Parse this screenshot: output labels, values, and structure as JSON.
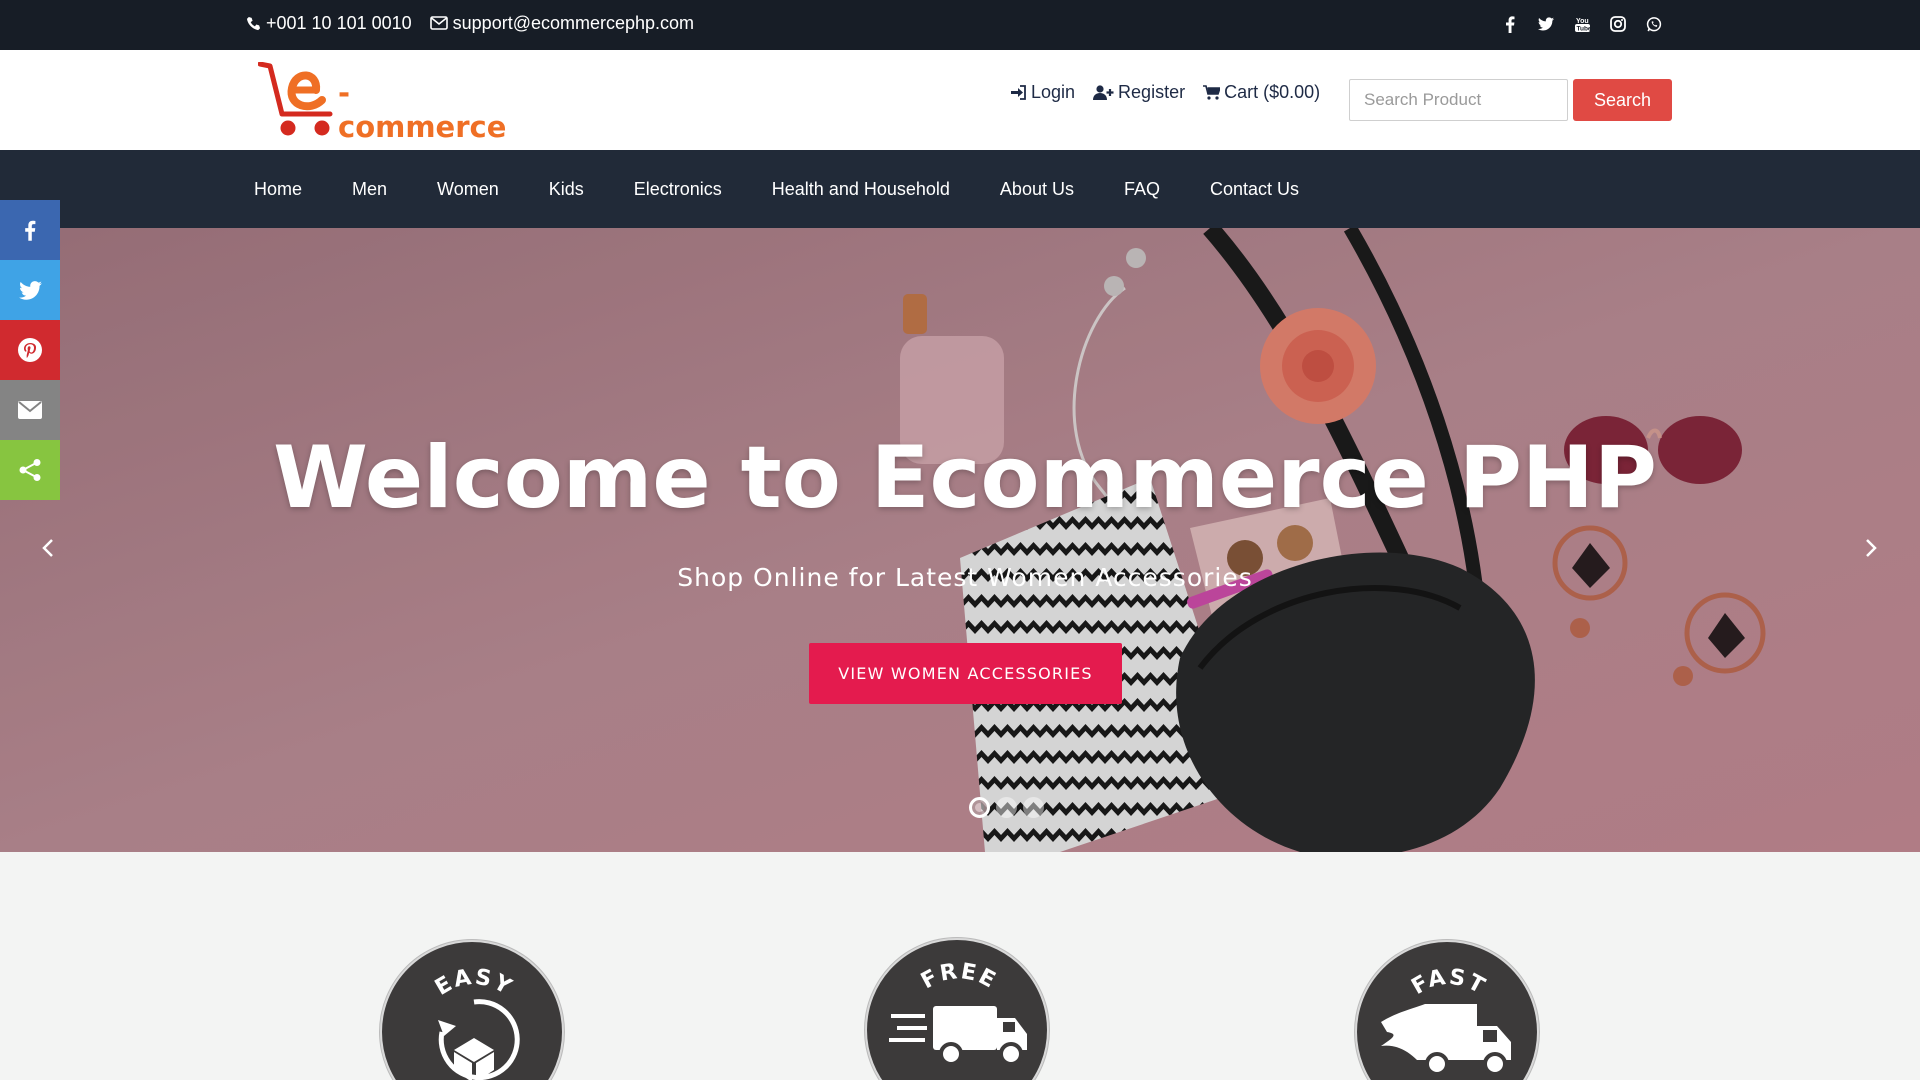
{
  "topbar": {
    "phone": "+001 10 101 0010",
    "email": "support@ecommercephp.com",
    "social_icons": [
      "facebook-icon",
      "twitter-icon",
      "youtube-icon",
      "instagram-icon",
      "whatsapp-icon"
    ]
  },
  "header": {
    "logo_text": "-commerce",
    "login": "Login",
    "register": "Register",
    "cart": "Cart ($0.00)",
    "search_placeholder": "Search Product",
    "search_button": "Search"
  },
  "nav": {
    "items": [
      "Home",
      "Men",
      "Women",
      "Kids",
      "Electronics",
      "Health and Household",
      "About Us",
      "FAQ",
      "Contact Us"
    ]
  },
  "hero": {
    "title": "Welcome to Ecommerce PHP",
    "subtitle": "Shop Online for Latest Women Accessories",
    "button": "VIEW WOMEN ACCESSORIES",
    "slide_count": 3,
    "active_slide": 1
  },
  "share_bar": [
    "facebook-icon",
    "twitter-icon",
    "pinterest-icon",
    "email-icon",
    "share-icon"
  ],
  "features": [
    {
      "badge_text": "EASY"
    },
    {
      "badge_text": "FREE"
    },
    {
      "badge_text": "FAST"
    }
  ],
  "colors": {
    "topbar": "#171d26",
    "nav": "#212a38",
    "search_button": "#e04a44",
    "hero_button": "#e41b4e",
    "logo": "#ef6f25",
    "logo_cart": "#d42a1f"
  }
}
